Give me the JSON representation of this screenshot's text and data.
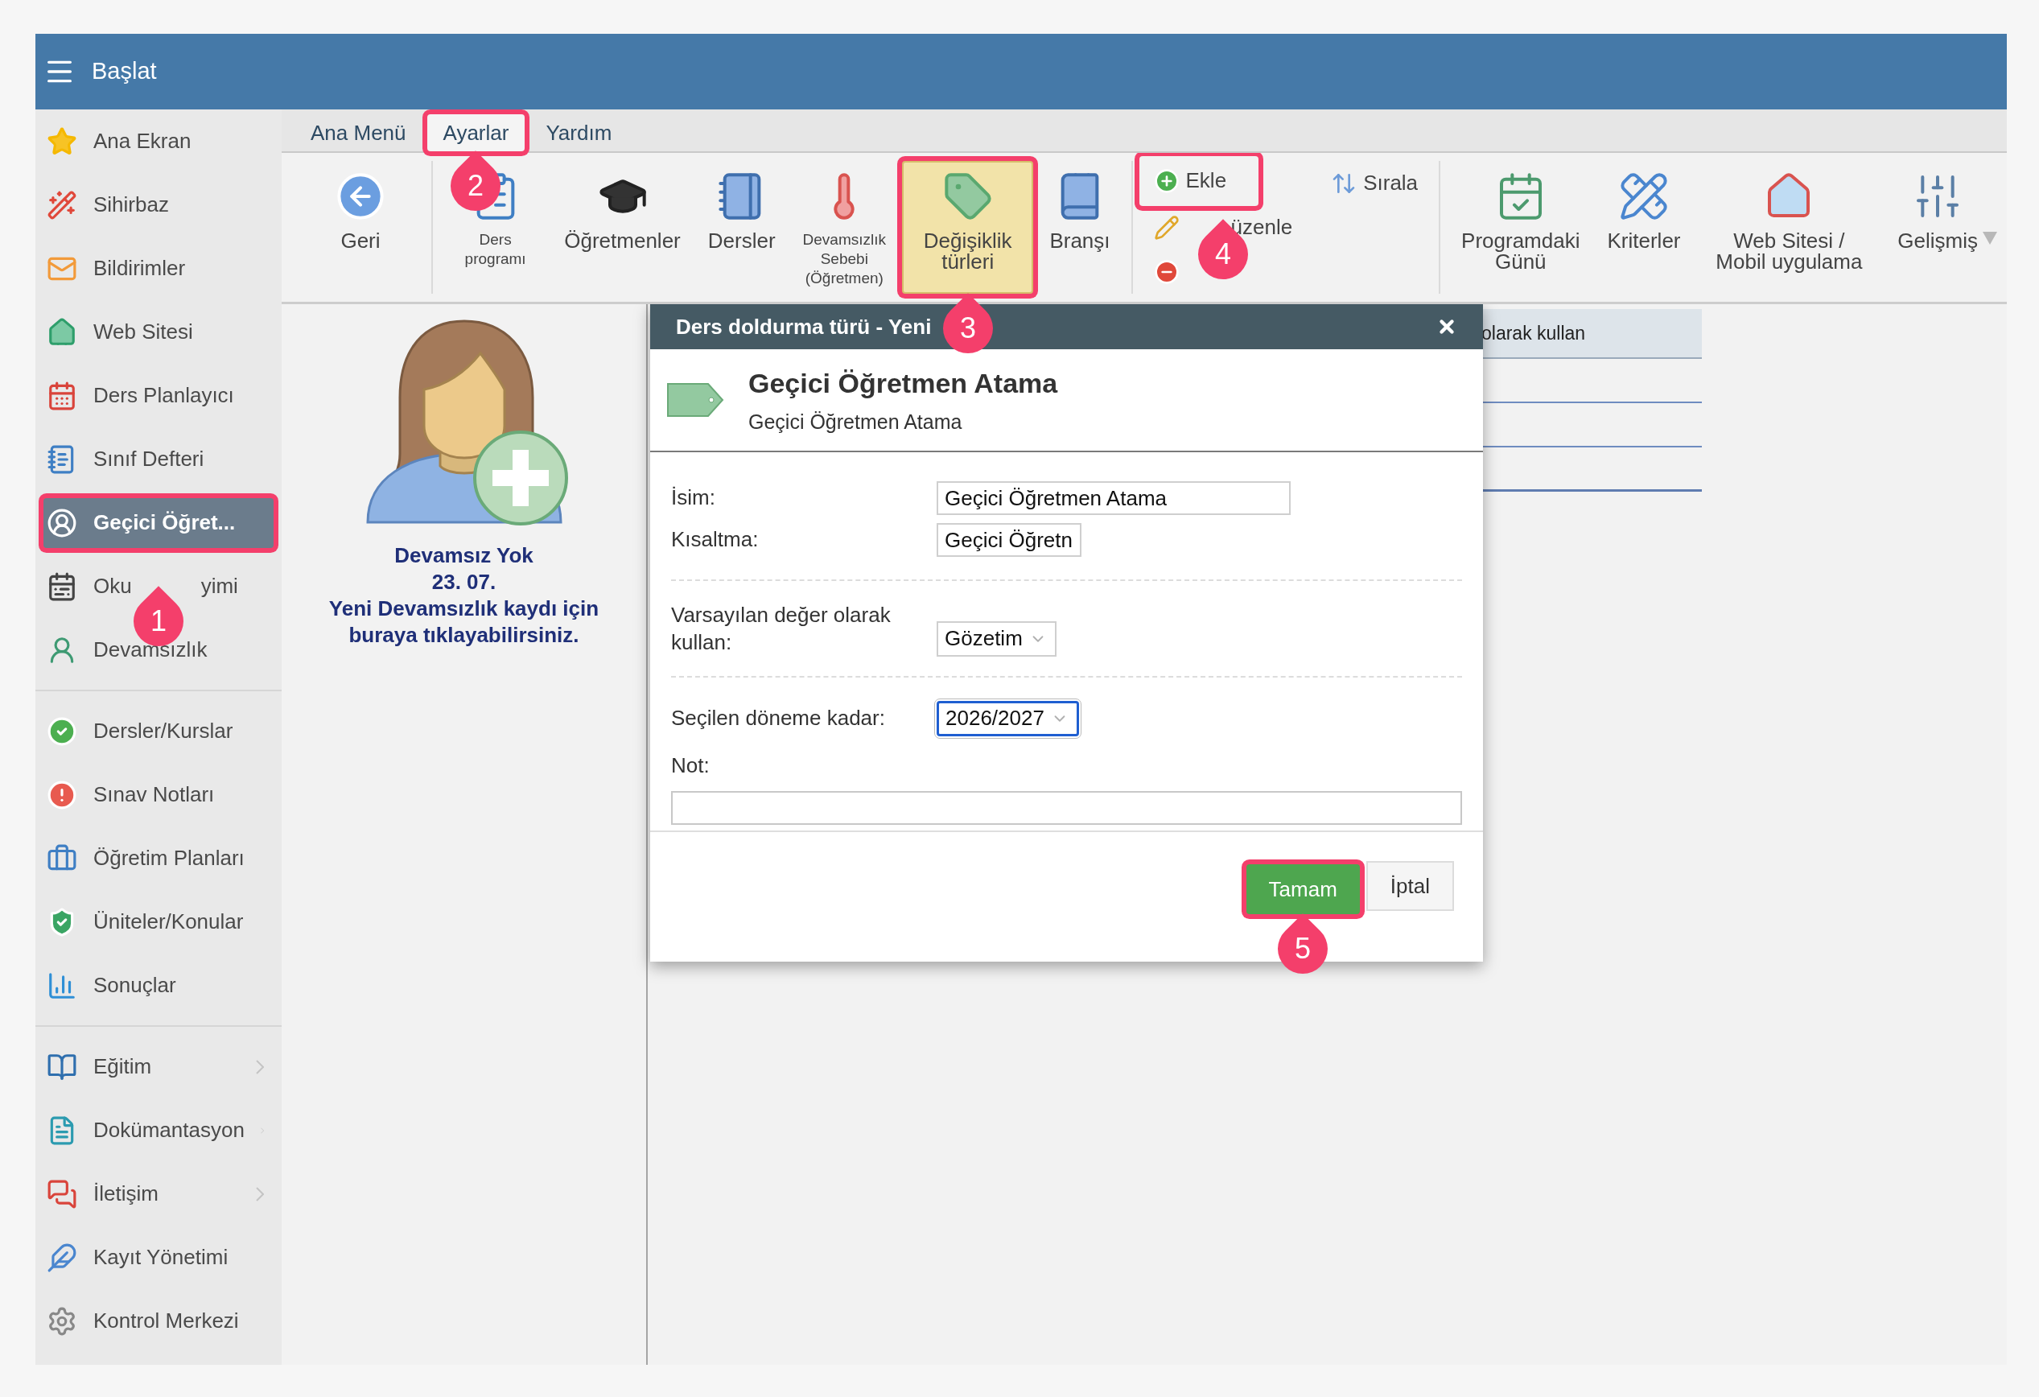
{
  "header": {
    "title": "Başlat"
  },
  "sidebar": {
    "groups": [
      {
        "items": [
          {
            "label": "Ana Ekran",
            "selected": false,
            "submenu": false
          },
          {
            "label": "Sihirbaz",
            "selected": false,
            "submenu": false
          },
          {
            "label": "Bildirimler",
            "selected": false,
            "submenu": false
          },
          {
            "label": "Web Sitesi",
            "selected": false,
            "submenu": false
          },
          {
            "label": "Ders Planlayıcı",
            "selected": false,
            "submenu": false
          },
          {
            "label": "Sınıf Defteri",
            "selected": false,
            "submenu": false
          },
          {
            "label": "Geçici Öğret...",
            "selected": true,
            "submenu": false,
            "callout": "1"
          },
          {
            "label": "Oku",
            "label_after": "yimi",
            "selected": false,
            "submenu": false
          },
          {
            "label": "Devamsızlık",
            "selected": false,
            "submenu": false
          }
        ]
      },
      {
        "items": [
          {
            "label": "Dersler/Kurslar",
            "selected": false,
            "submenu": false
          },
          {
            "label": "Sınav Notları",
            "selected": false,
            "submenu": false
          },
          {
            "label": "Öğretim Planları",
            "selected": false,
            "submenu": false
          },
          {
            "label": "Üniteler/Konular",
            "selected": false,
            "submenu": false
          },
          {
            "label": "Sonuçlar",
            "selected": false,
            "submenu": false
          }
        ]
      },
      {
        "items": [
          {
            "label": "Eğitim",
            "selected": false,
            "submenu": true
          },
          {
            "label": "Dokümantasyon",
            "selected": false,
            "submenu": true
          },
          {
            "label": "İletişim",
            "selected": false,
            "submenu": true
          },
          {
            "label": "Kayıt Yönetimi",
            "selected": false,
            "submenu": false
          },
          {
            "label": "Kontrol Merkezi",
            "selected": false,
            "submenu": false
          }
        ]
      }
    ]
  },
  "menu_tabs": [
    {
      "label": "Ana Menü",
      "selected": false
    },
    {
      "label": "Ayarlar",
      "selected": true,
      "callout": "2"
    },
    {
      "label": "Yardım",
      "selected": false
    }
  ],
  "ribbon": {
    "groups": [
      {
        "items": [
          {
            "kind": "large",
            "label": "Geri",
            "selected": false
          }
        ]
      },
      {
        "items": [
          {
            "kind": "small",
            "label": "Ders programı",
            "selected": false
          },
          {
            "kind": "large",
            "label": "Öğretmenler",
            "selected": false
          },
          {
            "kind": "large",
            "label": "Dersler",
            "selected": false
          },
          {
            "kind": "small",
            "label": "Devamsızlık Sebebi (Öğretmen)",
            "selected": false
          },
          {
            "kind": "large",
            "label": "Değişiklik türleri",
            "selected": true,
            "callout": "3"
          },
          {
            "kind": "large",
            "label": "Branşı",
            "selected": false
          }
        ]
      },
      {
        "items": [
          {
            "kind": "compact",
            "label": "Ekle",
            "callout": "4"
          },
          {
            "kind": "compact",
            "label": "üzenle"
          },
          {
            "kind": "compact"
          },
          {
            "kind": "compact",
            "label": "Sırala"
          }
        ]
      },
      {
        "items": [
          {
            "kind": "large",
            "label": "Programdaki Günü",
            "selected": false
          },
          {
            "kind": "large",
            "label": "Kriterler",
            "selected": false
          },
          {
            "kind": "large",
            "label": "Web Sitesi / Mobil uygulama",
            "selected": false
          },
          {
            "kind": "large",
            "label": "Gelişmiş",
            "selected": false,
            "dropdown": true
          }
        ]
      }
    ]
  },
  "absence_panel": {
    "title": "Devamsız Yok",
    "date": "23. 07.",
    "message": "Yeni Devamsızlık kaydı için buraya tıklayabilirsiniz."
  },
  "background_table": {
    "header": "olarak kullan"
  },
  "dialog": {
    "title": "Ders doldurma türü - Yeni",
    "heading": "Geçici Öğretmen Atama",
    "subheading": "Geçici Öğretmen Atama",
    "sections": [
      [
        {
          "kind": "text",
          "label": "İsim:",
          "value": "Geçici Öğretmen Atama"
        },
        {
          "kind": "short_text",
          "label": "Kısaltma:",
          "value": "Geçici Öğretn"
        }
      ],
      [
        {
          "kind": "select",
          "label": "Varsayılan değer olarak kullan:",
          "value": "Gözetim",
          "focused": false
        }
      ],
      [
        {
          "kind": "select",
          "label": "Seçilen döneme kadar:",
          "value": "2026/2027",
          "focused": true
        },
        {
          "kind": "textarea",
          "label": "Not:"
        }
      ]
    ],
    "buttons": [
      {
        "kind": "primary",
        "label": "Tamam",
        "callout": "5"
      },
      {
        "kind": "secondary",
        "label": "İptal"
      }
    ]
  }
}
